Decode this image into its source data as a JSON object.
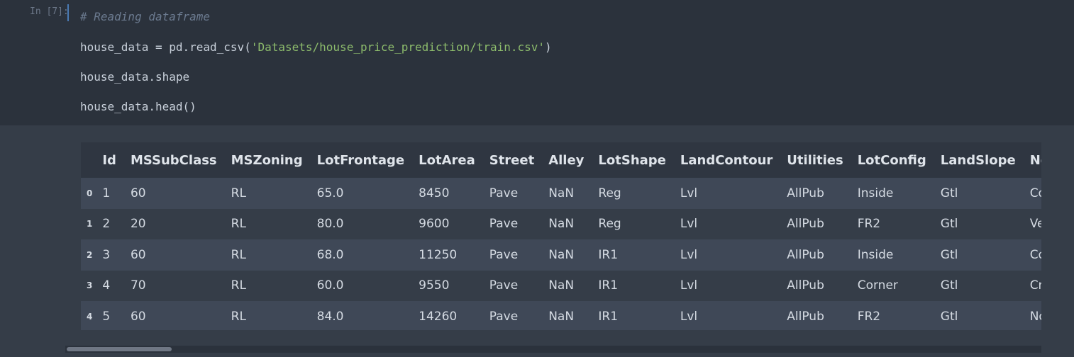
{
  "cell": {
    "prompt": "In [7]:",
    "code_lines": [
      {
        "comment": "# Reading dataframe"
      },
      {
        "pre": "house_data = pd.read_csv(",
        "str": "'Datasets/house_price_prediction/train.csv'",
        "post": ")"
      },
      {
        "pre": "house_data.shape"
      },
      {
        "pre": "house_data.head()"
      }
    ]
  },
  "dataframe": {
    "columns": [
      "Id",
      "MSSubClass",
      "MSZoning",
      "LotFrontage",
      "LotArea",
      "Street",
      "Alley",
      "LotShape",
      "LandContour",
      "Utilities",
      "LotConfig",
      "LandSlope",
      "Neighborhood"
    ],
    "rows": [
      {
        "index": "0",
        "cells": [
          "1",
          "60",
          "RL",
          "65.0",
          "8450",
          "Pave",
          "NaN",
          "Reg",
          "Lvl",
          "AllPub",
          "Inside",
          "Gtl",
          "CollgCr"
        ]
      },
      {
        "index": "1",
        "cells": [
          "2",
          "20",
          "RL",
          "80.0",
          "9600",
          "Pave",
          "NaN",
          "Reg",
          "Lvl",
          "AllPub",
          "FR2",
          "Gtl",
          "Veenker"
        ]
      },
      {
        "index": "2",
        "cells": [
          "3",
          "60",
          "RL",
          "68.0",
          "11250",
          "Pave",
          "NaN",
          "IR1",
          "Lvl",
          "AllPub",
          "Inside",
          "Gtl",
          "CollgCr"
        ]
      },
      {
        "index": "3",
        "cells": [
          "4",
          "70",
          "RL",
          "60.0",
          "9550",
          "Pave",
          "NaN",
          "IR1",
          "Lvl",
          "AllPub",
          "Corner",
          "Gtl",
          "Crawfor"
        ]
      },
      {
        "index": "4",
        "cells": [
          "5",
          "60",
          "RL",
          "84.0",
          "14260",
          "Pave",
          "NaN",
          "IR1",
          "Lvl",
          "AllPub",
          "FR2",
          "Gtl",
          "NoRidge"
        ]
      }
    ]
  },
  "colors": {
    "background": "#2b323c",
    "output_background": "#353d48",
    "row_stripe": "#3f4857",
    "string_literal": "#8dbc6c",
    "comment": "#6b7a8f",
    "prompt_bar": "#4a7bb5"
  }
}
